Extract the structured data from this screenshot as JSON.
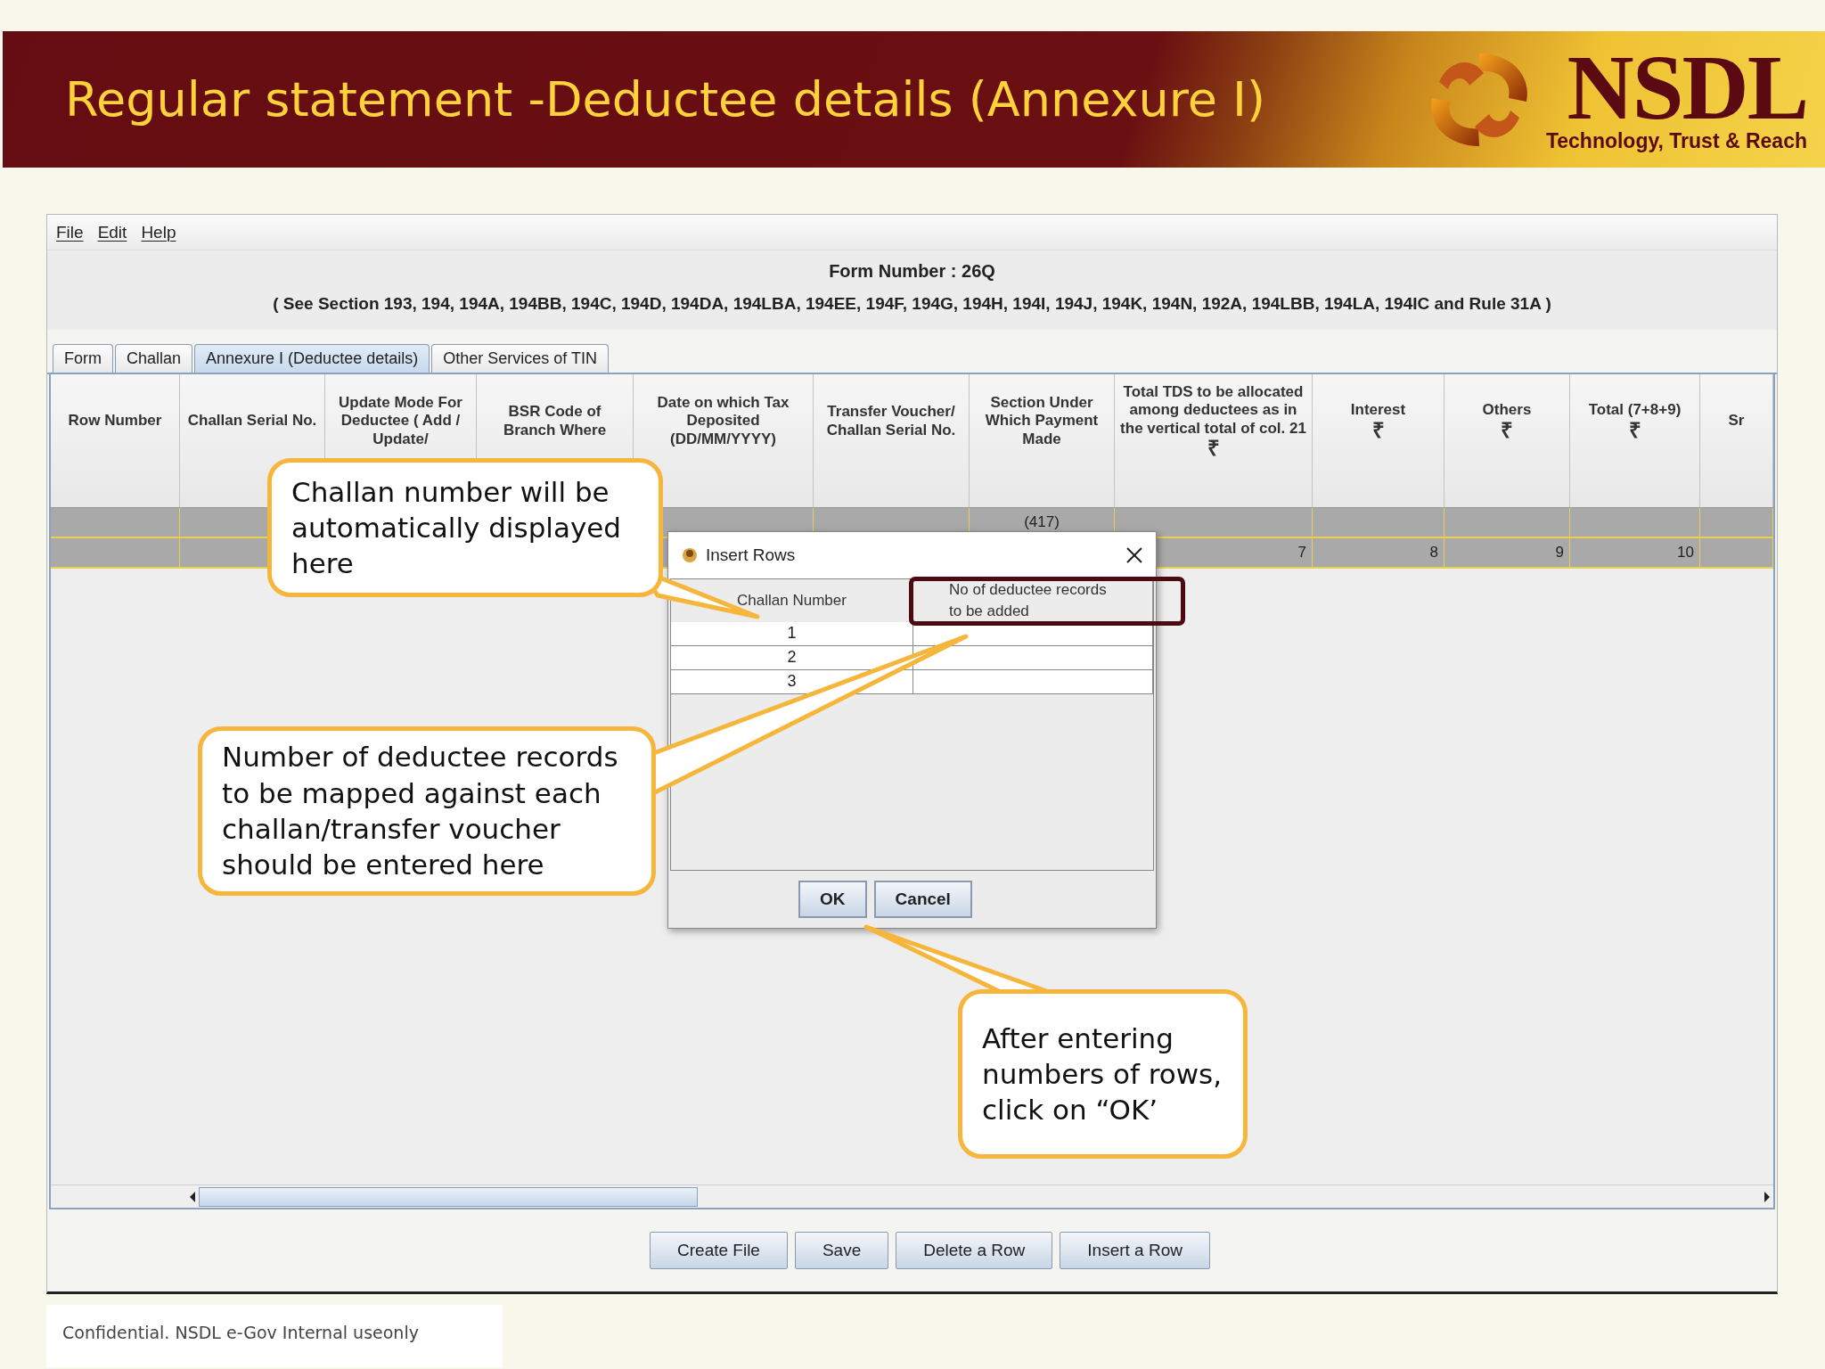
{
  "slide_title": "Regular statement -Deductee details (Annexure I)",
  "logo": {
    "name": "NSDL",
    "tagline": "Technology, Trust & Reach"
  },
  "app": {
    "menu": [
      "File",
      "Edit",
      "Help"
    ],
    "form_number": "Form Number : 26Q",
    "sections": "( See Section 193, 194, 194A, 194BB, 194C, 194D, 194DA, 194LBA, 194EE, 194F, 194G, 194H, 194I, 194J, 194K, 194N, 192A, 194LBB, 194LA, 194IC and Rule 31A )",
    "tabs": [
      {
        "label": "Form",
        "selected": false
      },
      {
        "label": "Challan",
        "selected": false
      },
      {
        "label": "Annexure I (Deductee details)",
        "selected": true
      },
      {
        "label": "Other Services of TIN",
        "selected": false
      }
    ],
    "table": {
      "columns": [
        {
          "label": "Row Number"
        },
        {
          "label": "Challan Serial No."
        },
        {
          "label": "Update Mode For Deductee ( Add / Update/"
        },
        {
          "label": "BSR Code of Branch Where"
        },
        {
          "label": "Date on which Tax Deposited (DD/MM/YYYY)"
        },
        {
          "label": "Transfer Voucher/ Challan Serial No."
        },
        {
          "label": "Section Under Which Payment Made"
        },
        {
          "label": "Total TDS to be allocated among deductees as in the vertical total of col. 21",
          "symbol": "₹"
        },
        {
          "label": "Interest",
          "symbol": "₹"
        },
        {
          "label": "Others",
          "symbol": "₹"
        },
        {
          "label": "Total (7+8+9)",
          "symbol": "₹"
        },
        {
          "label": "Sr"
        }
      ],
      "rows": [
        [
          "",
          "",
          "",
          "",
          "",
          "",
          "(417)",
          "",
          "",
          "",
          "",
          ""
        ],
        [
          "",
          "",
          "",
          "",
          "",
          "",
          "",
          "7",
          "8",
          "9",
          "10",
          ""
        ]
      ]
    },
    "buttons": [
      "Create File",
      "Save",
      "Delete a Row",
      "Insert a Row"
    ]
  },
  "dialog": {
    "title": "Insert Rows",
    "columns": [
      "Challan Number",
      "No of deductee records to be added"
    ],
    "rows": [
      [
        "1",
        ""
      ],
      [
        "2",
        ""
      ],
      [
        "3",
        ""
      ]
    ],
    "buttons": [
      "OK",
      "Cancel"
    ]
  },
  "callouts": [
    {
      "text": "Challan number will be automatically  displayed here"
    },
    {
      "text": "Number of deductee records to be mapped against each challan/transfer voucher should be entered here"
    },
    {
      "text": "After entering numbers of rows, click on “OK’"
    }
  ],
  "footer": "Confidential. NSDL e-Gov Internal useonly"
}
